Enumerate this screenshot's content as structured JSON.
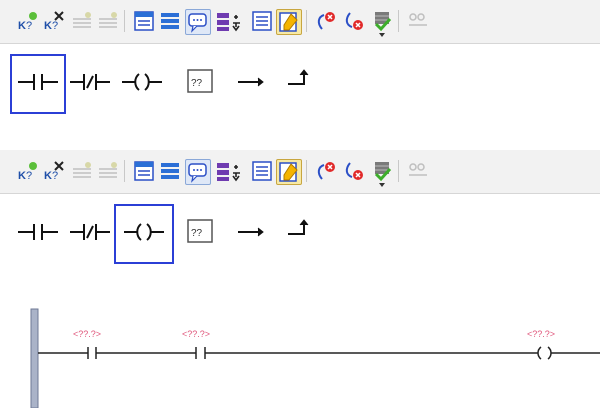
{
  "toolbar": {
    "icons": [
      "insert-network-icon",
      "delete-network-icon",
      "insert-rung-icon",
      "delete-rung-icon",
      "network-overview-icon",
      "network-list-icon",
      "comment-icon",
      "open-branch-icon",
      "list-view-icon",
      "highlight-icon",
      "go-to-error-icon",
      "go-to-next-error-icon",
      "compile-icon",
      "monitor-icon"
    ]
  },
  "instructions": {
    "items": [
      {
        "name": "normally-open-contact-button",
        "icon": "no-contact-icon"
      },
      {
        "name": "normally-closed-contact-button",
        "icon": "nc-contact-icon"
      },
      {
        "name": "coil-button",
        "icon": "coil-icon"
      },
      {
        "name": "empty-box-button",
        "icon": "empty-box-icon"
      },
      {
        "name": "open-branch-button",
        "icon": "open-branch-arrow-icon"
      },
      {
        "name": "close-branch-button",
        "icon": "close-branch-arrow-icon"
      }
    ],
    "selected_top": "normally-open-contact-button",
    "selected_bottom": "coil-button"
  },
  "ladder": {
    "contact1_operand": "<??.?>",
    "contact2_operand": "<??.?>",
    "coil_operand": "<??.?>"
  },
  "colors": {
    "selection": "#2b3fd6",
    "placeholder": "#e0557a",
    "rail": "#8a95b0"
  }
}
